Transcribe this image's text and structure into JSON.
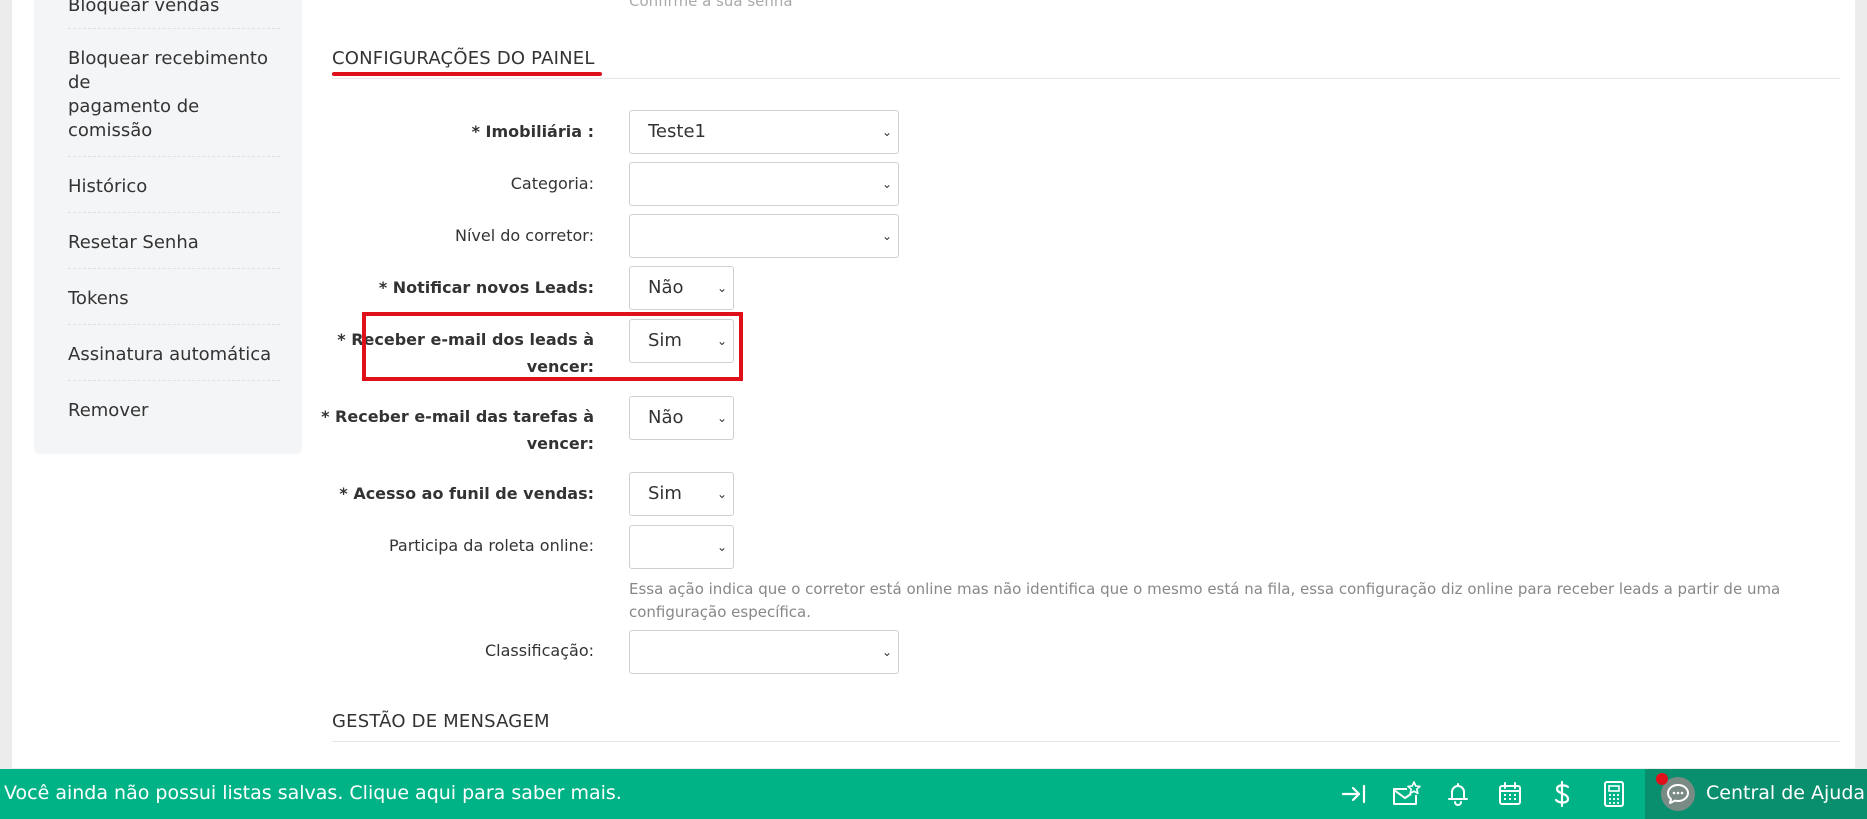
{
  "sidebar": {
    "items": [
      {
        "label": "Bloquear vendas"
      },
      {
        "label": "Bloquear recebimento de pagamento de comissão",
        "lines": [
          "Bloquear recebimento",
          "de",
          "pagamento de",
          "comissão"
        ]
      },
      {
        "label": "Histórico"
      },
      {
        "label": "Resetar Senha"
      },
      {
        "label": "Tokens"
      },
      {
        "label": "Assinatura automática"
      },
      {
        "label": "Remover"
      }
    ]
  },
  "main": {
    "confirm_password_hint": "Confirme a sua senha",
    "panel_section": {
      "title": "CONFIGURAÇÕES DO PAINEL",
      "fields": [
        {
          "label": "* Imobiliária :",
          "value": "Teste1"
        },
        {
          "label": "Categoria:",
          "value": ""
        },
        {
          "label": "Nível do corretor:",
          "value": ""
        },
        {
          "label": "* Notificar novos Leads:",
          "value": "Não"
        },
        {
          "label_line1": "* Receber e-mail dos leads à",
          "label_line2": "vencer:",
          "value": "Sim"
        },
        {
          "label_line1": "* Receber e-mail das tarefas à",
          "label_line2": "vencer:",
          "value": "Não"
        },
        {
          "label": "* Acesso ao funil de vendas:",
          "value": "Sim"
        },
        {
          "label": "Participa da roleta online:",
          "value": ""
        },
        {
          "label": "Classificação:",
          "value": ""
        }
      ],
      "roleta_help": "Essa ação indica que o corretor está online mas não identifica que o mesmo está na fila, essa configuração diz online para receber leads a partir de uma configuração específica."
    },
    "message_section": {
      "title": "GESTÃO DE MENSAGEM"
    }
  },
  "bottombar": {
    "message": "Você ainda não possui listas salvas. Clique aqui para saber mais.",
    "icons": [
      "collapse-arrow-icon",
      "mail-star-icon",
      "bell-icon",
      "calendar-icon",
      "dollar-icon",
      "calculator-icon"
    ],
    "help_center_label": "Central de Ajuda"
  },
  "colors": {
    "accent_green": "#00b386",
    "highlight_red": "#e0101a"
  }
}
